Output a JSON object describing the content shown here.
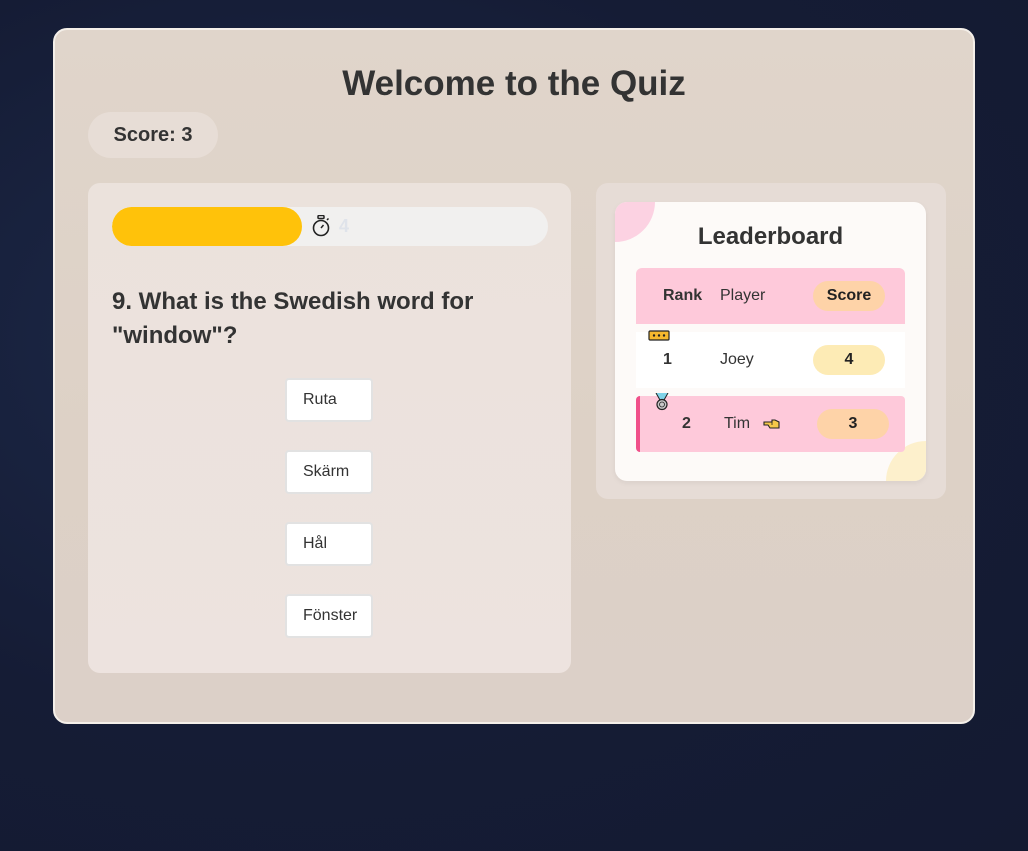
{
  "quiz": {
    "title": "Welcome to the Quiz",
    "score_label": "Score: 3"
  },
  "timer": {
    "remaining_seconds": "4",
    "progress_fraction": 0.435,
    "icon": "stopwatch-icon",
    "fill_color": "#ffc20a"
  },
  "question": {
    "text": "9. What is the Swedish word for \"window\"?",
    "answers": [
      "Ruta",
      "Skärm",
      "Hål",
      "Fönster"
    ]
  },
  "leaderboard": {
    "title": "Leaderboard",
    "headers": {
      "rank": "Rank",
      "player": "Player",
      "score": "Score"
    },
    "rows": [
      {
        "rank": "1",
        "player": "Joey",
        "score": "4",
        "icon": "crown-icon"
      },
      {
        "rank": "2",
        "player": "Tim",
        "score": "3",
        "icon": "medal-icon",
        "current_player_icon": "pointing-hand-icon"
      }
    ],
    "colors": {
      "row_highlight": "#fec9da",
      "accent": "#f0508a"
    }
  }
}
